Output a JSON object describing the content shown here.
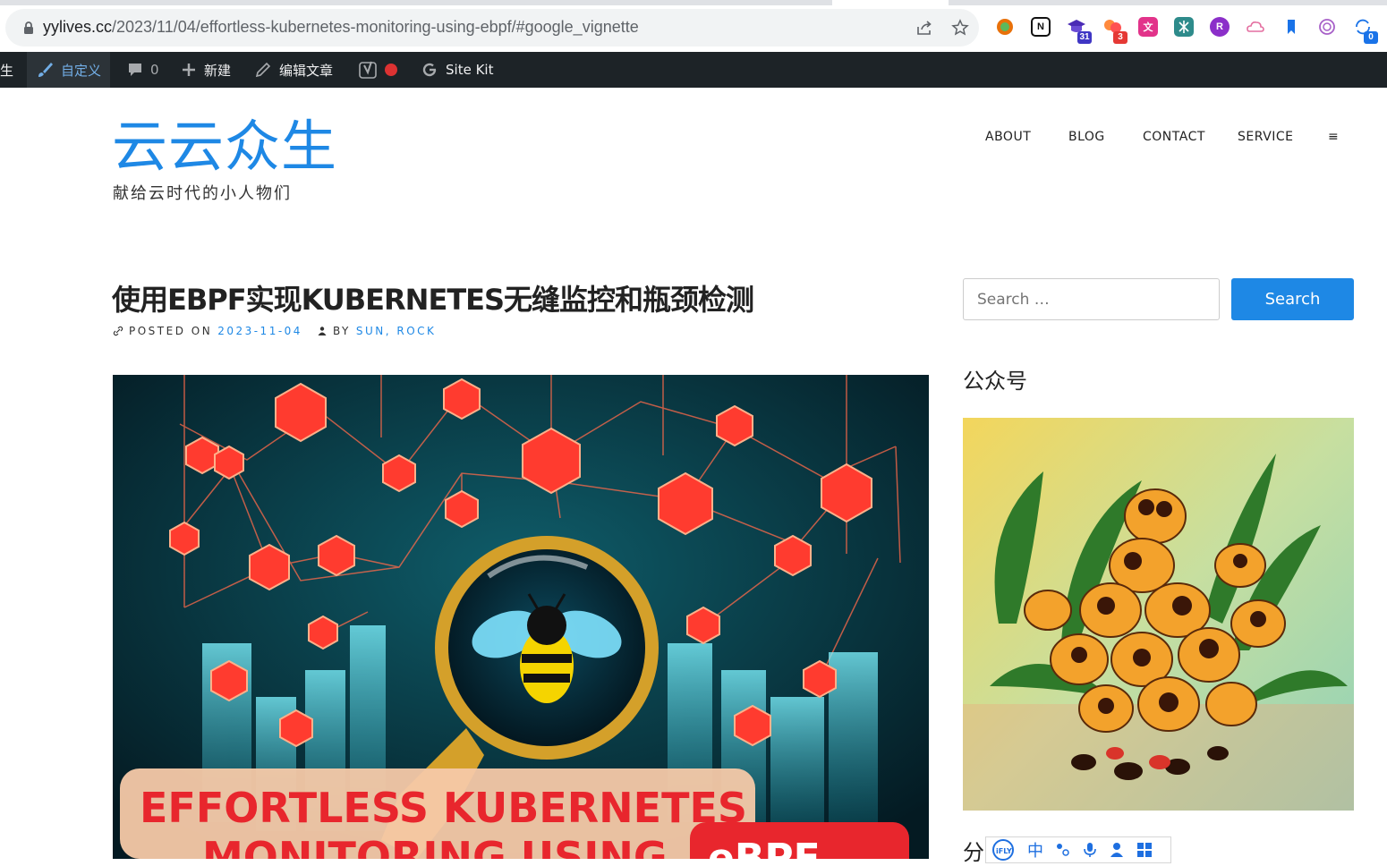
{
  "browser": {
    "url_host": "yylives.cc",
    "url_path": "/2023/11/04/effortless-kubernetes-monitoring-using-ebpf/#google_vignette",
    "extensions": [
      {
        "name": "circle-ext-icon",
        "color": "#e8710a",
        "badge": ""
      },
      {
        "name": "notion-icon",
        "color": "#111111",
        "label": "N",
        "badge": ""
      },
      {
        "name": "graduation-cap-icon",
        "color": "#4a2bb5",
        "badge": "31",
        "badge_color": "#3f36c4"
      },
      {
        "name": "dots-ext-icon",
        "color": "#ff6a3d",
        "badge": "3",
        "badge_color": "#e53935"
      },
      {
        "name": "translate-icon",
        "color": "#e2338a",
        "label": "文",
        "badge": ""
      },
      {
        "name": "ai-ext-icon",
        "color": "#2e8b8b",
        "badge": ""
      },
      {
        "name": "lr-ext-icon",
        "color": "#8b2fc9",
        "label": "R",
        "badge": ""
      },
      {
        "name": "cloud-ext-icon",
        "color": "#e46fa0",
        "badge": ""
      },
      {
        "name": "bookmark-ext-icon",
        "color": "#1a73e8",
        "badge": ""
      },
      {
        "name": "openai-icon",
        "color": "#a760c8",
        "badge": ""
      },
      {
        "name": "sync-ext-icon",
        "color": "#1a73e8",
        "badge": "0",
        "badge_color": "#1a73e8"
      }
    ]
  },
  "adminbar": {
    "site_fragment": "生",
    "customize": "自定义",
    "comments_count": "0",
    "new": "新建",
    "edit": "编辑文章",
    "sitekit": "Site Kit"
  },
  "site": {
    "title": "云云众生",
    "description": "献给云时代的小人物们",
    "nav": [
      "ABOUT",
      "BLOG",
      "CONTACT",
      "SERVICE",
      "≡"
    ]
  },
  "post": {
    "title": "使用EBPF实现KUBERNETES无缝监控和瓶颈检测",
    "posted_on_label": "POSTED ON",
    "date": "2023-11-04",
    "by_label": "BY",
    "authors": "SUN, ROCK",
    "hero_text_line1": "EFFORTLESS KUBERNETES",
    "hero_text_line2": "MONITORING USING",
    "hero_badge": "eBPF"
  },
  "sidebar": {
    "search_placeholder": "Search …",
    "search_button": "Search",
    "widget_title": "公众号",
    "widget_title2": "分"
  },
  "ime": {
    "brand": "iFLY",
    "mode": "中"
  },
  "colors": {
    "accent": "#1e88e5",
    "adminbar": "#1d2327"
  }
}
